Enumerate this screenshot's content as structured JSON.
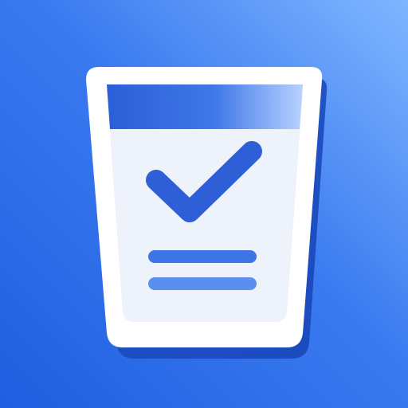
{
  "icon": {
    "name": "checklist-cup-app-icon",
    "symbol": "checkmark-icon"
  },
  "colors": {
    "background_start": "#1f5fe0",
    "background_end": "#7fb6ff",
    "accent": "#2f5fd6",
    "card": "#ffffff",
    "panel": "#eef2fb",
    "text_lines": "#3d74e6"
  }
}
